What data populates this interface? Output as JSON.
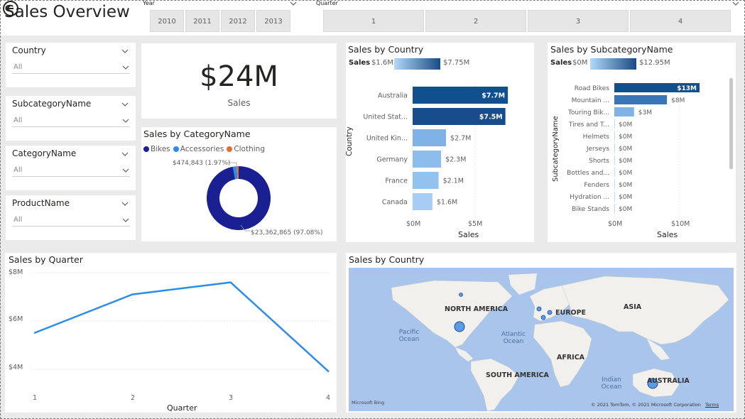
{
  "page": {
    "title": "Sales Overview"
  },
  "year_slicer": {
    "label": "Year",
    "options": [
      "2010",
      "2011",
      "2012",
      "2013"
    ]
  },
  "quarter_slicer": {
    "label": "Quarter",
    "options": [
      "1",
      "2",
      "3",
      "4"
    ]
  },
  "filters": [
    {
      "label": "Country",
      "value": "All"
    },
    {
      "label": "SubcategoryName",
      "value": "All"
    },
    {
      "label": "CategoryName",
      "value": "All"
    },
    {
      "label": "ProductName",
      "value": "All"
    }
  ],
  "kpi": {
    "value": "$24M",
    "label": "Sales"
  },
  "donut": {
    "title": "Sales by CategoryName",
    "legend": [
      {
        "name": "Bikes",
        "color": "#1a1f91"
      },
      {
        "name": "Accessories",
        "color": "#2b8de8"
      },
      {
        "name": "Clothing",
        "color": "#e66c37"
      }
    ],
    "label_small": "$474,843 (1.97%)",
    "label_big": "$23,362,865 (97.08%)"
  },
  "country_bar": {
    "title": "Sales by Country",
    "legend_label": "Sales",
    "legend_min": "$1.6M",
    "legend_max": "$7.75M",
    "y_axis_title": "Country",
    "x_axis_title": "Sales",
    "x_ticks": [
      "$0M",
      "$5M"
    ],
    "categories": [
      "Australia",
      "United Stat...",
      "United Kin...",
      "Germany",
      "France",
      "Canada"
    ],
    "value_labels": [
      "$7.7M",
      "$7.5M",
      "$2.7M",
      "$2.3M",
      "$2.1M",
      "$1.6M"
    ]
  },
  "subcat_bar": {
    "title": "Sales by SubcategoryName",
    "legend_label": "Sales",
    "legend_min": "$0M",
    "legend_max": "$12.95M",
    "y_axis_title": "SubcategoryName",
    "x_axis_title": "Sales",
    "x_ticks": [
      "$0M",
      "$10M"
    ],
    "categories": [
      "Road Bikes",
      "Mountain ...",
      "Touring Bik...",
      "Tires and T...",
      "Helmets",
      "Jerseys",
      "Shorts",
      "Bottles and...",
      "Fenders",
      "Hydration ...",
      "Bike Stands"
    ],
    "value_labels": [
      "$13M",
      "$8M",
      "$3M",
      "$0M",
      "$0M",
      "$0M",
      "$0M",
      "$0M",
      "$0M",
      "$0M",
      "$0M"
    ]
  },
  "quarter_line": {
    "title": "Sales by Quarter",
    "x_axis_title": "Quarter",
    "y_ticks": [
      "$8M",
      "$6M",
      "$4M"
    ],
    "x_ticks": [
      "1",
      "2",
      "3",
      "4"
    ]
  },
  "map": {
    "title": "Sales by Country",
    "labels": {
      "north_america": "NORTH AMERICA",
      "europe": "EUROPE",
      "asia": "ASIA",
      "africa": "AFRICA",
      "south_america": "SOUTH AMERICA",
      "australia": "AUSTRALIA",
      "pacific": "Pacific Ocean",
      "atlantic": "Atlantic Ocean",
      "indian": "Indian Ocean"
    },
    "attribution": "© 2021 TomTom, © 2021 Microsoft Corporation",
    "terms": "Terms",
    "bing": "Microsoft Bing"
  },
  "chart_data": [
    {
      "type": "pie",
      "title": "Sales by CategoryName",
      "categories": [
        "Bikes",
        "Accessories",
        "Clothing"
      ],
      "values": [
        23362865,
        474843,
        227000
      ],
      "percent": [
        97.08,
        1.97,
        0.95
      ]
    },
    {
      "type": "bar",
      "title": "Sales by Country",
      "xlabel": "Sales",
      "ylabel": "Country",
      "categories": [
        "Australia",
        "United States",
        "United Kingdom",
        "Germany",
        "France",
        "Canada"
      ],
      "values": [
        7.7,
        7.5,
        2.7,
        2.3,
        2.1,
        1.6
      ],
      "xlim": [
        0,
        7.75
      ]
    },
    {
      "type": "bar",
      "title": "Sales by SubcategoryName",
      "xlabel": "Sales",
      "ylabel": "SubcategoryName",
      "categories": [
        "Road Bikes",
        "Mountain ...",
        "Touring Bik...",
        "Tires and T...",
        "Helmets",
        "Jerseys",
        "Shorts",
        "Bottles and...",
        "Fenders",
        "Hydration ...",
        "Bike Stands"
      ],
      "values": [
        12.95,
        8,
        3,
        0,
        0,
        0,
        0,
        0,
        0,
        0,
        0
      ],
      "xlim": [
        0,
        12.95
      ]
    },
    {
      "type": "line",
      "title": "Sales by Quarter",
      "xlabel": "Quarter",
      "x": [
        1,
        2,
        3,
        4
      ],
      "values": [
        5.5,
        7.1,
        7.6,
        3.9
      ],
      "ylim": [
        3.7,
        8.0
      ]
    }
  ]
}
